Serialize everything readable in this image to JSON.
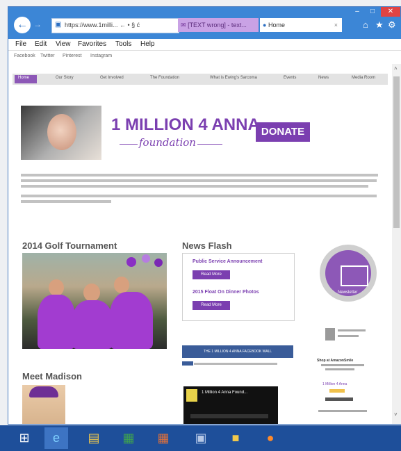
{
  "browser": {
    "address_text": "https://www.1milli...  ← • § ć",
    "tabs": [
      {
        "label": "[TEXT wrong] - text..."
      },
      {
        "label": "Home"
      }
    ],
    "window_controls": [
      "–",
      "□",
      "✕"
    ],
    "menu": [
      "File",
      "Edit",
      "View",
      "Favorites",
      "Tools",
      "Help"
    ],
    "favorites": [
      "Facebook",
      "Twitter",
      "Pinterest",
      "Instagram"
    ]
  },
  "site": {
    "nav": [
      "Home",
      "Our Story",
      "Get Involved",
      "The Foundation",
      "What is Ewing's Sarcoma",
      "Events",
      "News",
      "Media Room"
    ],
    "brand_title": "1 MILLION 4 ANNA",
    "brand_subtitle": "foundation",
    "donate_label": "DONATE",
    "golf_heading": "2014 Golf Tournament",
    "news_heading": "News Flash",
    "news_items": [
      {
        "title": "Public Service Announcement",
        "button": "Read More"
      },
      {
        "title": "2015 Float On Dinner Photos",
        "button": "Read More"
      }
    ],
    "newsletter_label": "Newsletter",
    "facebook_wall": "THE 1 MILLION 4 ANNA FACEBOOK WALL",
    "madison_heading": "Meet Madison",
    "video_title": "1 Million 4 Anna Found...",
    "shop_text": "Shop at AmazonSmile",
    "amazon_label": "1 Million 4 Anna"
  },
  "colors": {
    "purple": "#7b3fb0",
    "titlebar": "#3c86d6",
    "taskbar": "#1e4f9a"
  },
  "taskbar_icons": [
    "windows-start-icon",
    "ie-icon",
    "file-explorer-icon",
    "excel-icon",
    "powerpoint-icon",
    "photos-icon",
    "folder-icon",
    "firefox-icon"
  ]
}
